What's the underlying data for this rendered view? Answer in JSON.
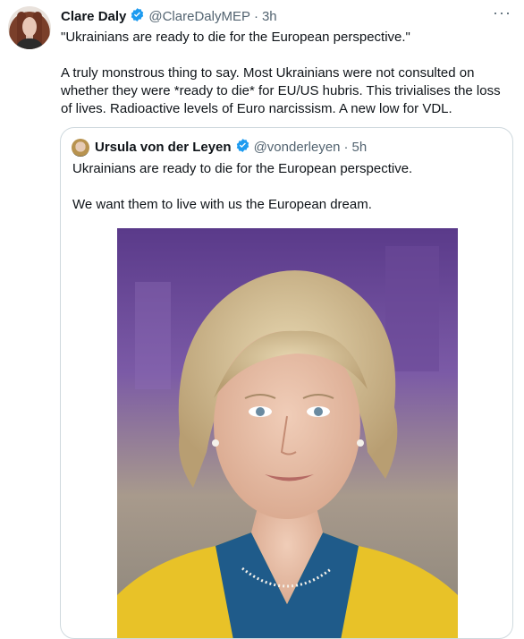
{
  "tweet": {
    "author_name": "Clare Daly",
    "handle": "@ClareDalyMEP",
    "separator": "·",
    "time": "3h",
    "more_label": "···",
    "paragraphs": [
      "\"Ukrainians are ready to die for the European perspective.\"",
      "A truly monstrous thing to say. Most Ukrainians were not consulted on whether they were *ready to die* for EU/US hubris. This trivialises the loss of lives. Radioactive levels of Euro narcissism. A new low for VDL."
    ]
  },
  "quoted": {
    "author_name": "Ursula von der Leyen",
    "handle": "@vonderleyen",
    "separator": "·",
    "time": "5h",
    "paragraphs": [
      "Ukrainians are ready to die for the European perspective.",
      "We want them to live with us the European dream."
    ]
  },
  "colors": {
    "verified": "#1d9bf0",
    "secondary_text": "#536471",
    "border": "#cfd9de"
  }
}
